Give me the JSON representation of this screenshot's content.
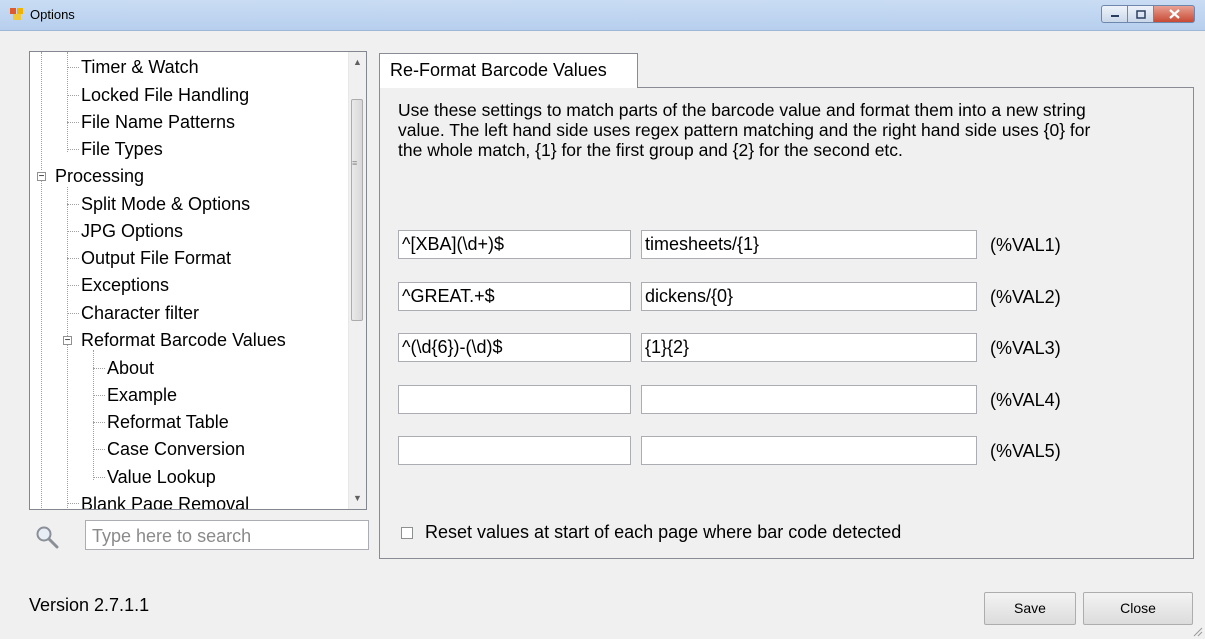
{
  "window": {
    "title": "Options"
  },
  "tree": {
    "items": [
      {
        "label": "Timer & Watch",
        "level": 1
      },
      {
        "label": "Locked File Handling",
        "level": 1
      },
      {
        "label": "File Name Patterns",
        "level": 1
      },
      {
        "label": "File Types",
        "level": 1
      },
      {
        "label": "Processing",
        "level": 0,
        "expander": "−"
      },
      {
        "label": "Split Mode & Options",
        "level": 1
      },
      {
        "label": "JPG Options",
        "level": 1
      },
      {
        "label": "Output File Format",
        "level": 1
      },
      {
        "label": "Exceptions",
        "level": 1
      },
      {
        "label": "Character filter",
        "level": 1
      },
      {
        "label": "Reformat Barcode Values",
        "level": 1,
        "expander": "−"
      },
      {
        "label": "About",
        "level": 2
      },
      {
        "label": "Example",
        "level": 2
      },
      {
        "label": "Reformat Table",
        "level": 2
      },
      {
        "label": "Case Conversion",
        "level": 2
      },
      {
        "label": "Value Lookup",
        "level": 2
      },
      {
        "label": "Blank Page Removal",
        "level": 1
      }
    ]
  },
  "search": {
    "placeholder": "Type here to search"
  },
  "tab": {
    "label": "Re-Format Barcode Values",
    "description": "Use these settings to match parts of the barcode value and format them into a new string value. The left hand side uses regex pattern matching and the right hand side uses {0} for the whole match, {1} for the first group and {2} for the second etc."
  },
  "rows": [
    {
      "pattern": "^[XBA](\\d+)$",
      "format": "timesheets/{1}",
      "label": "(%VAL1)"
    },
    {
      "pattern": "^GREAT.+$",
      "format": "dickens/{0}",
      "label": "(%VAL2)"
    },
    {
      "pattern": "^(\\d{6})-(\\d)$",
      "format": "{1}{2}",
      "label": "(%VAL3)"
    },
    {
      "pattern": "",
      "format": "",
      "label": "(%VAL4)"
    },
    {
      "pattern": "",
      "format": "",
      "label": "(%VAL5)"
    }
  ],
  "reset_checkbox": {
    "label": "Reset values at start of each page where bar code detected",
    "checked": false
  },
  "footer": {
    "version": "Version 2.7.1.1",
    "save_label": "Save",
    "close_label": "Close"
  }
}
